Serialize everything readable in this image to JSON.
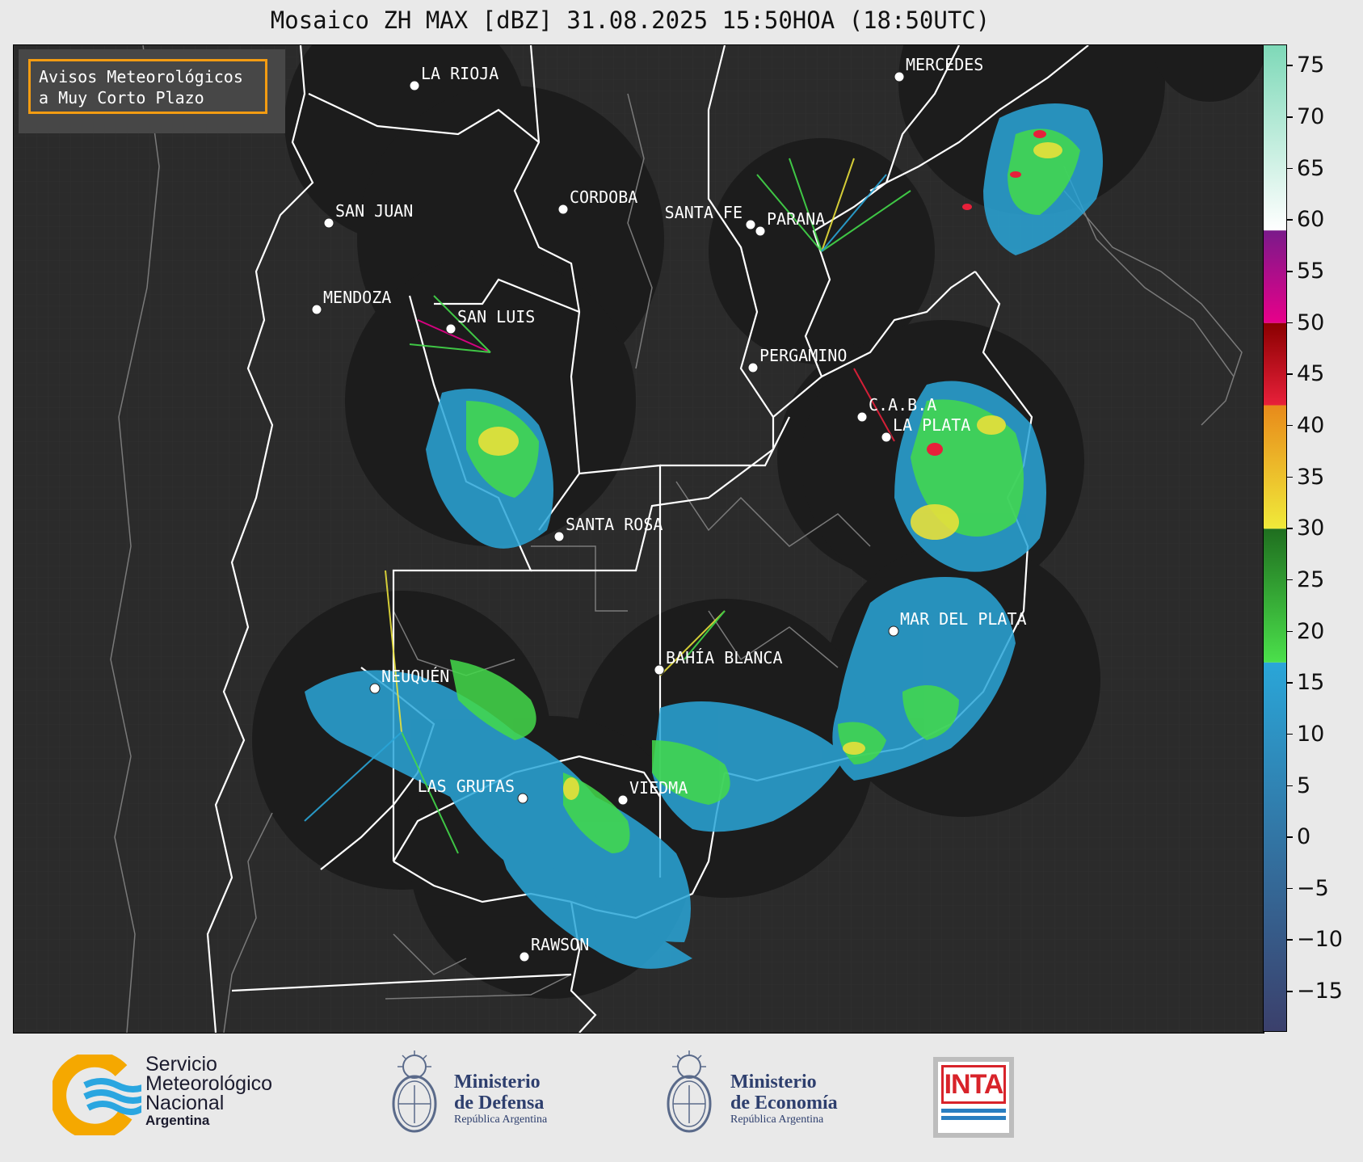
{
  "title": "Mosaico ZH MAX [dBZ] 31.08.2025 15:50HOA (18:50UTC)",
  "notice": {
    "line1": "Avisos Meteorológicos",
    "line2": "a Muy Corto Plazo",
    "border_color": "#f39c12"
  },
  "map": {
    "background": "#2b2b2b",
    "radar_coverage_color": "#1c1c1c",
    "cities": [
      {
        "name": "LA RIOJA"
      },
      {
        "name": "MERCEDES"
      },
      {
        "name": "CORDOBA"
      },
      {
        "name": "SAN JUAN"
      },
      {
        "name": "SANTA FE"
      },
      {
        "name": "PARANA"
      },
      {
        "name": "MENDOZA"
      },
      {
        "name": "SAN LUIS"
      },
      {
        "name": "PERGAMINO"
      },
      {
        "name": "C.A.B.A"
      },
      {
        "name": "LA PLATA"
      },
      {
        "name": "SANTA ROSA"
      },
      {
        "name": "MAR DEL PLATA"
      },
      {
        "name": "BAHÍA BLANCA"
      },
      {
        "name": "NEUQUÉN"
      },
      {
        "name": "LAS GRUTAS"
      },
      {
        "name": "VIEDMA"
      },
      {
        "name": "RAWSON"
      }
    ]
  },
  "colorbar": {
    "unit": "dBZ",
    "range": [
      -19,
      77
    ],
    "tick_labels": [
      "75",
      "70",
      "65",
      "60",
      "55",
      "50",
      "45",
      "40",
      "35",
      "30",
      "25",
      "20",
      "15",
      "10",
      "5",
      "0",
      "−5",
      "−10",
      "−15"
    ],
    "tick_values": [
      75,
      70,
      65,
      60,
      55,
      50,
      45,
      40,
      35,
      30,
      25,
      20,
      15,
      10,
      5,
      0,
      -5,
      -10,
      -15
    ],
    "bands": [
      {
        "from": -19,
        "to": 17,
        "color_low": "#3b3f6b",
        "color_high": "#2aa6d8"
      },
      {
        "from": 17,
        "to": 30,
        "color_low": "#4be04b",
        "color_high": "#1f6e1f"
      },
      {
        "from": 30,
        "to": 42,
        "color_low": "#f0ea3a",
        "color_high": "#e88a1a"
      },
      {
        "from": 42,
        "to": 50,
        "color_low": "#e8203a",
        "color_high": "#8a0000"
      },
      {
        "from": 50,
        "to": 59,
        "color_low": "#e8008a",
        "color_high": "#7a1a8a"
      },
      {
        "from": 59,
        "to": 77,
        "color_low": "#ffffff",
        "color_high": "#7ed9b8"
      }
    ]
  },
  "footer": {
    "smn": {
      "line1": "Servicio",
      "line2": "Meteorológico",
      "line3": "Nacional",
      "line4": "Argentina"
    },
    "defensa": {
      "line1": "Ministerio",
      "line2": "de Defensa",
      "line3": "República Argentina"
    },
    "economia": {
      "line1": "Ministerio",
      "line2": "de Economía",
      "line3": "República Argentina"
    },
    "inta": {
      "text": "INTA"
    }
  }
}
